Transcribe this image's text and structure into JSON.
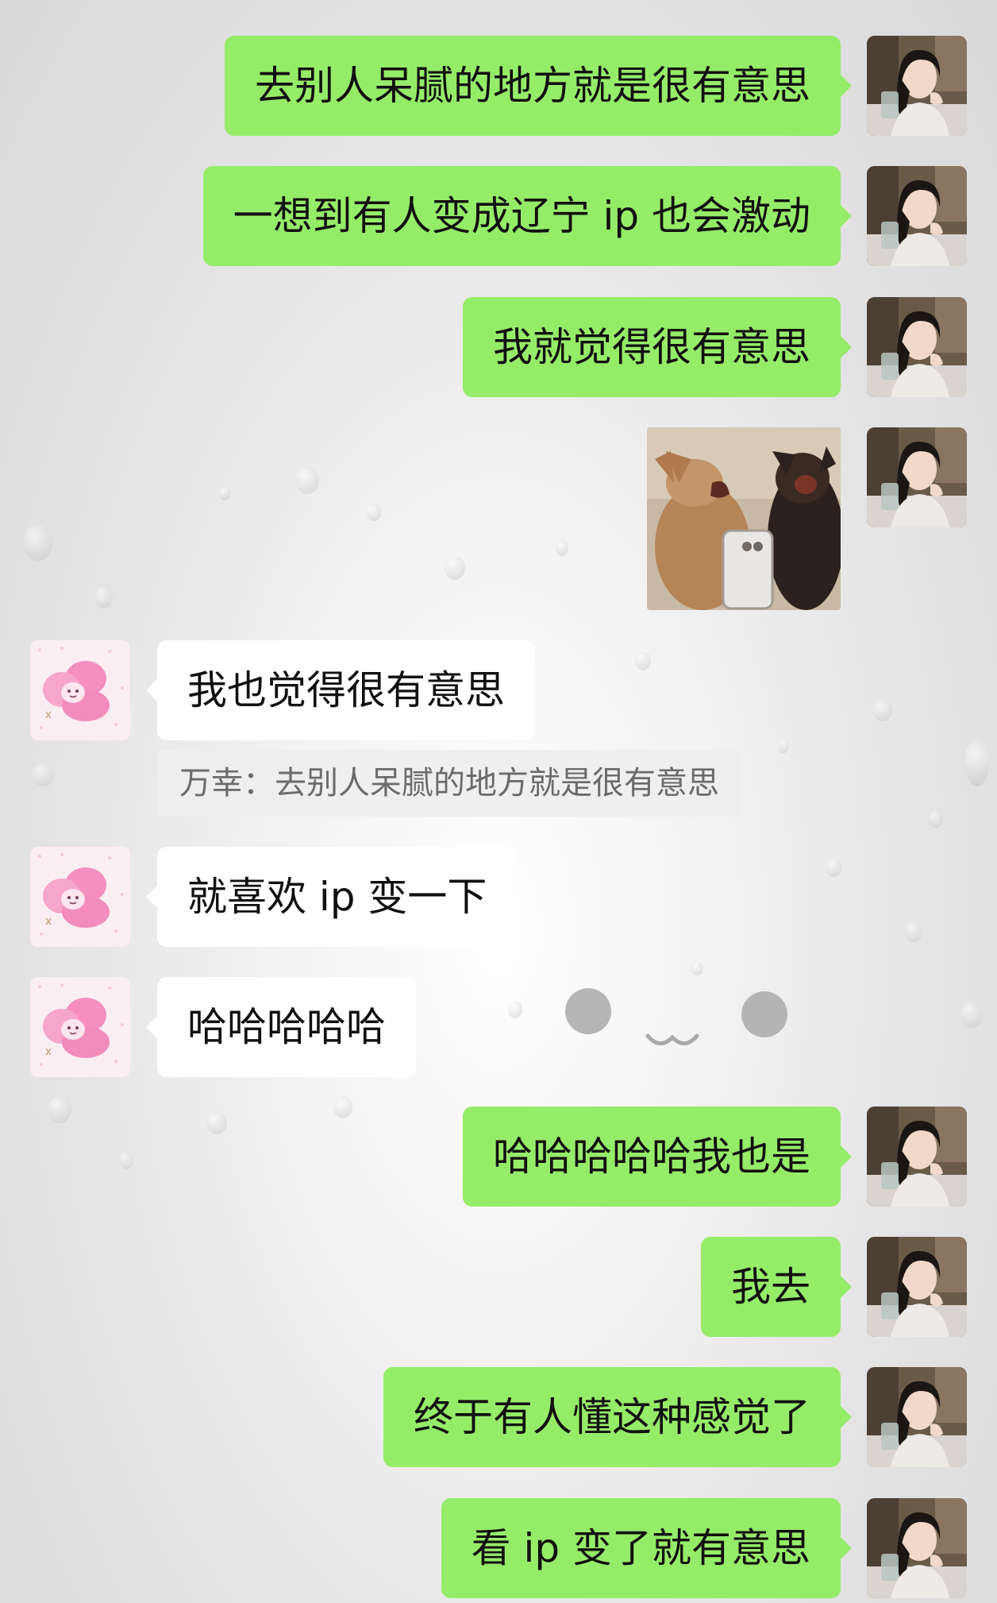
{
  "messages": [
    {
      "side": "me",
      "text": "去别人呆腻的地方就是很有意思"
    },
    {
      "side": "me",
      "text": "一想到有人变成辽宁 ip 也会激动"
    },
    {
      "side": "me",
      "text": "我就觉得很有意思"
    },
    {
      "side": "me",
      "type": "sticker",
      "icon": "laughing-dogs-sticker"
    },
    {
      "side": "other",
      "text": "我也觉得很有意思",
      "quote": "万幸：去别人呆腻的地方就是很有意思"
    },
    {
      "side": "other",
      "text": "就喜欢 ip 变一下"
    },
    {
      "side": "other",
      "text": "哈哈哈哈哈"
    },
    {
      "side": "me",
      "text": "哈哈哈哈哈我也是"
    },
    {
      "side": "me",
      "text": "我去"
    },
    {
      "side": "me",
      "text": "终于有人懂这种感觉了"
    },
    {
      "side": "me",
      "text": "看 ip 变了就有意思"
    }
  ],
  "colors": {
    "me_bubble": "#95ec69",
    "other_bubble": "#ffffff",
    "quote_bg": "#eeeeee"
  },
  "avatars": {
    "me": "girl-photo-avatar",
    "other": "pink-cartoon-avatar"
  }
}
